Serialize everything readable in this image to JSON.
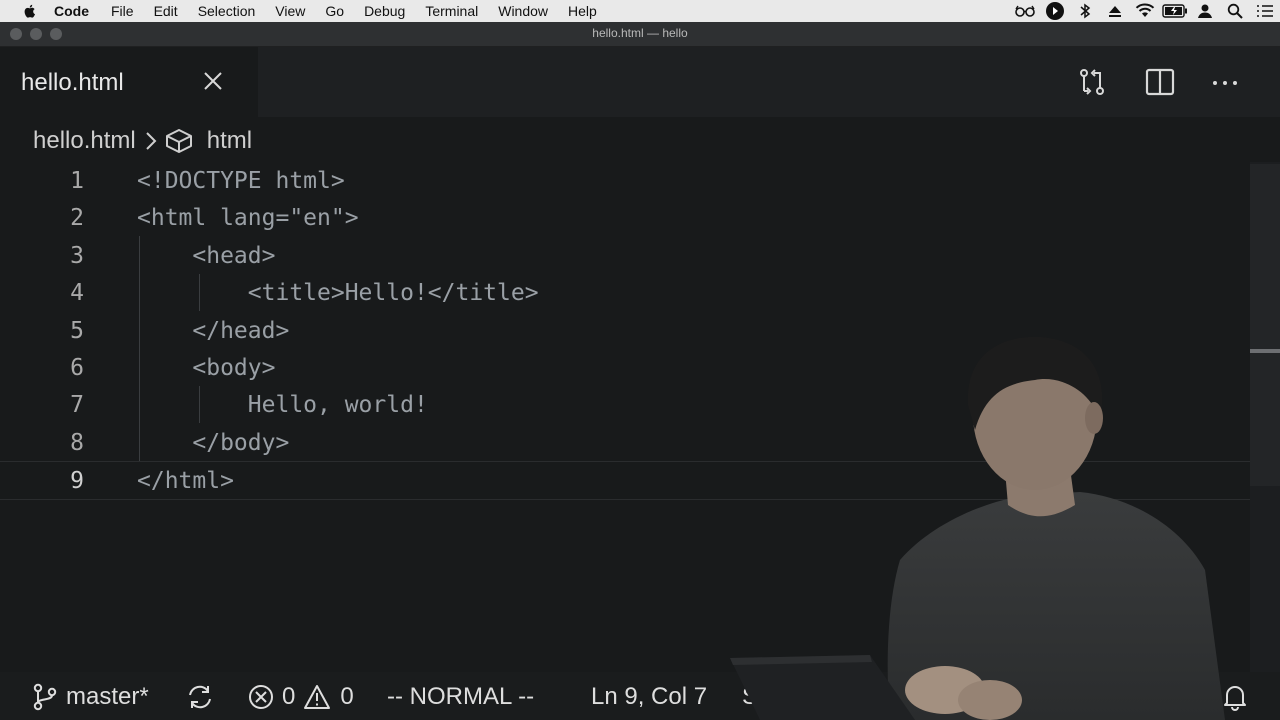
{
  "menubar": {
    "app_name": "Code",
    "items": [
      "File",
      "Edit",
      "Selection",
      "View",
      "Go",
      "Debug",
      "Terminal",
      "Window",
      "Help"
    ],
    "tray_icons": [
      "glasses-icon",
      "play-circle-icon",
      "bluetooth-icon",
      "eject-icon",
      "wifi-icon",
      "battery-icon",
      "user-icon",
      "search-icon",
      "list-icon"
    ]
  },
  "window": {
    "title": "hello.html — hello"
  },
  "tabs": [
    {
      "label": "hello.html",
      "active": true
    }
  ],
  "breadcrumb": {
    "file": "hello.html",
    "symbol": "html"
  },
  "editor": {
    "lines": [
      {
        "num": "1",
        "text": "<!DOCTYPE html>"
      },
      {
        "num": "2",
        "text": "<html lang=\"en\">"
      },
      {
        "num": "3",
        "text": "    <head>"
      },
      {
        "num": "4",
        "text": "        <title>Hello!</title>"
      },
      {
        "num": "5",
        "text": "    </head>"
      },
      {
        "num": "6",
        "text": "    <body>"
      },
      {
        "num": "7",
        "text": "        Hello, world!"
      },
      {
        "num": "8",
        "text": "    </body>"
      },
      {
        "num": "9",
        "text": "</html>"
      }
    ]
  },
  "statusbar": {
    "branch": "master*",
    "errors": "0",
    "warnings": "0",
    "mode": "-- NORMAL --",
    "position": "Ln 9, Col 7",
    "partial": "S"
  },
  "colors": {
    "background": "#181a1b",
    "menubar": "#e9e9e9",
    "text": "#d4d4d4"
  }
}
